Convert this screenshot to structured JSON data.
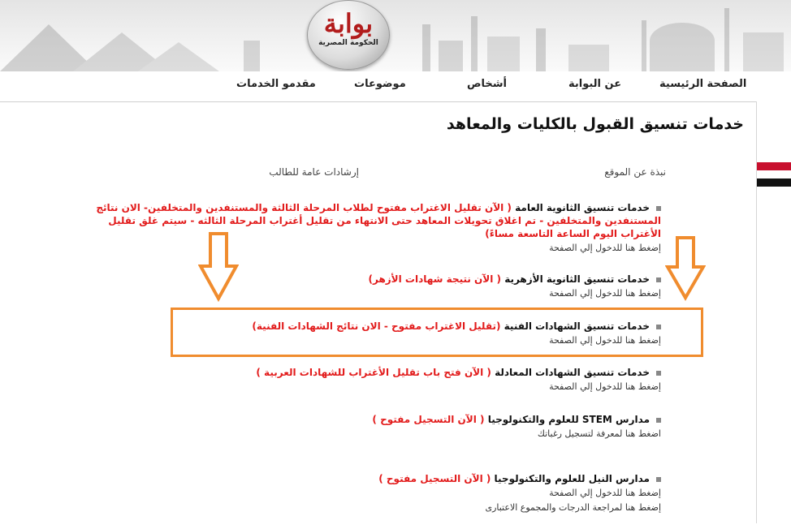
{
  "logo": {
    "main": "بوابة",
    "sub": "الحكومة المصرية"
  },
  "nav": {
    "home": "الصفحة الرئيسية",
    "about": "عن البوابة",
    "persons": "أشخاص",
    "topics": "موضوعات",
    "providers": "مقدمو الخدمات"
  },
  "page_title": "خدمات تنسيق القبول بالكليات والمعاهد",
  "tabs": {
    "about_site": "نبذة عن الموقع",
    "guidance": "إرشادات عامة للطالب"
  },
  "entries": [
    {
      "title": "خدمات تنسيق الثانوية العامة",
      "status": "( الآن تقليل الاغتراب مفتوح لطلاب المرحلة الثالثة والمستنفدين والمتخلفين- الان نتائج المستنفدين والمتخلفين - تم اغلاق تحويلات المعاهد حتى الانتهاء من تقليل أغتراب المرحلة الثالثه - سيتم غلق تقليل الأغتراب اليوم الساعة التاسعة مساءً)",
      "links": [
        "إضغط هنا للدخول إلي الصفحة"
      ]
    },
    {
      "title": "خدمات تنسيق الثانوية الأزهرية",
      "status": "( الآن نتيجة شهادات الأزهر)",
      "links": [
        "إضغط هنا للدخول إلي الصفحة"
      ]
    },
    {
      "title": "خدمات تنسيق الشهادات الفنية",
      "status": "(تقليل الاغتراب مفتوح - الان نتائج الشهادات الفنية)",
      "links": [
        "إضغط هنا للدخول إلي الصفحة"
      ]
    },
    {
      "title": "خدمات تنسيق الشهادات المعادلة",
      "status": "( الآن فتح باب تقليل الأغتراب للشهادات العربية )",
      "links": [
        "إضغط هنا للدخول إلي الصفحة"
      ]
    },
    {
      "title": "مدارس STEM للعلوم والتكنولوجيا",
      "status": "( الآن التسجيل مفتوح )",
      "links": [
        "اضغط هنا لمعرفة لتسجيل رغباتك"
      ]
    },
    {
      "title": "مدارس النيل للعلوم والتكنولوجيا",
      "status": "( الآن التسجيل مفتوح )",
      "links": [
        "إضغط هنا للدخول إلي الصفحة",
        "إضغط هنا لمراجعة الدرجات والمجموع الاعتبارى"
      ]
    }
  ],
  "colors": {
    "status_red": "#e21b1b",
    "highlight_orange": "#f08c2e",
    "logo_red": "#b21c1c"
  }
}
